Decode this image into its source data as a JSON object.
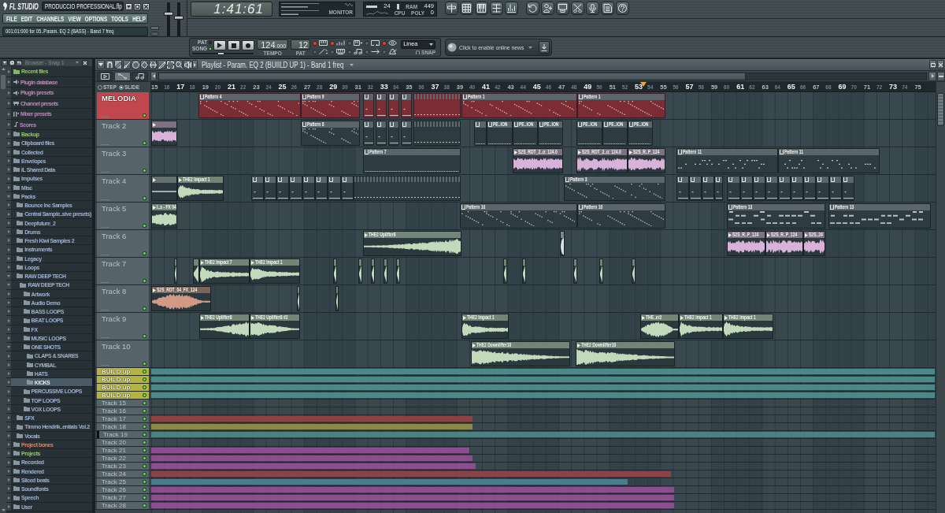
{
  "app": {
    "logo": "FL STUDIO",
    "title": "PRODUCCIO PROFESSIONAL.flp",
    "menu": [
      "FILE",
      "EDIT",
      "CHANNELS",
      "VIEW",
      "OPTIONS",
      "TOOLS",
      "HELP"
    ],
    "hint": "001:01:000 for 05..Param. EQ 2 (BASS) - Band 7 freq"
  },
  "master": {
    "volume": {
      "level": 0.68
    },
    "pitch": {
      "level": 0.55
    }
  },
  "song_time": "1:41:61",
  "monitor": {
    "label": "MONITOR"
  },
  "performance": {
    "cpu": "24",
    "ram_label": "RAM",
    "poly": "449",
    "cpu_label": "CPU",
    "poly_label": "POLY",
    "count": "0"
  },
  "transport": {
    "modes": [
      {
        "label": "PAT",
        "selected": false
      },
      {
        "label": "SONG",
        "selected": true
      }
    ],
    "position": {
      "level": 0.47
    },
    "tempo": "124",
    "tempo_decimals": ".000",
    "tempo_label": "TEMPO",
    "pattern": "12",
    "pattern_label": "PAT",
    "toggles": [
      {
        "on": true
      },
      {
        "on": true
      },
      {
        "on": false
      },
      {
        "on": false
      },
      {
        "on": true
      },
      {
        "on": false
      },
      {
        "on": false
      },
      {
        "on": false
      },
      {
        "on": false
      },
      {
        "on": false
      }
    ]
  },
  "snap": {
    "value": "Linea",
    "label": "SNAP"
  },
  "news": {
    "text": "Click to enable online news"
  },
  "browser": {
    "title": "Browser - Snap 1",
    "items": [
      {
        "label": "Recent files",
        "kind": "recent",
        "color": "#8ec46a",
        "expanded": false,
        "selected": false
      },
      {
        "label": "Plugin database",
        "kind": "plugin",
        "color": "#b98bbb",
        "expanded": false,
        "selected": false
      },
      {
        "label": "Plugin presets",
        "kind": "plugin",
        "color": "#b98bbb",
        "expanded": false,
        "selected": false
      },
      {
        "label": "Channel presets",
        "kind": "channel",
        "color": "#b98bbb",
        "expanded": false,
        "selected": false
      },
      {
        "label": "Mixer presets",
        "kind": "mixer",
        "color": "#b98bbb",
        "expanded": false,
        "selected": false
      },
      {
        "label": "Scores",
        "kind": "score",
        "color": "#b98bbb",
        "expanded": false,
        "selected": false
      },
      {
        "label": "Backup",
        "kind": "folder",
        "color": "#8ec46a",
        "expanded": false,
        "selected": false
      },
      {
        "label": "Clipboard files",
        "kind": "folder",
        "color": "#9db1cf",
        "expanded": false,
        "selected": false
      },
      {
        "label": "Collected",
        "kind": "folder",
        "color": "#9db1cf",
        "expanded": false,
        "selected": false
      },
      {
        "label": "Envelopes",
        "kind": "folder",
        "color": "#9db1cf",
        "expanded": false,
        "selected": false
      },
      {
        "label": "IL Shared Data",
        "kind": "folder",
        "color": "#9db1cf",
        "expanded": false,
        "selected": false
      },
      {
        "label": "Impulses",
        "kind": "folder",
        "color": "#9db1cf",
        "expanded": false,
        "selected": false
      },
      {
        "label": "Misc",
        "kind": "folder",
        "color": "#9db1cf",
        "expanded": false,
        "selected": false
      },
      {
        "label": "Packs",
        "kind": "folder",
        "color": "#9db1cf",
        "expanded": true,
        "selected": false,
        "children": [
          {
            "label": "Bounce Inc Samples",
            "kind": "folder",
            "color": "#9db1cf",
            "expanded": false,
            "selected": false
          },
          {
            "label": "Central Sample..sive presets)",
            "kind": "folder",
            "color": "#9db1cf",
            "expanded": false,
            "selected": false
          },
          {
            "label": "Deepfuture_2",
            "kind": "folder",
            "color": "#9db1cf",
            "expanded": false,
            "selected": false
          },
          {
            "label": "Drums",
            "kind": "folder",
            "color": "#9db1cf",
            "expanded": false,
            "selected": false
          },
          {
            "label": "Fresh Kiwi Samples 2",
            "kind": "folder",
            "color": "#9db1cf",
            "expanded": false,
            "selected": false
          },
          {
            "label": "Instruments",
            "kind": "folder",
            "color": "#9db1cf",
            "expanded": false,
            "selected": false
          },
          {
            "label": "Legacy",
            "kind": "folder",
            "color": "#9db1cf",
            "expanded": false,
            "selected": false
          },
          {
            "label": "Loops",
            "kind": "folder",
            "color": "#9db1cf",
            "expanded": false,
            "selected": false
          },
          {
            "label": "RAW DEEP TECH",
            "kind": "folder",
            "color": "#9db1cf",
            "expanded": true,
            "selected": false,
            "children": [
              {
                "label": "RAW DEEP TECH",
                "kind": "folder",
                "color": "#9db1cf",
                "expanded": true,
                "selected": false,
                "children": [
                  {
                    "label": "Artwork",
                    "kind": "folder",
                    "color": "#9db1cf",
                    "expanded": false,
                    "selected": false
                  },
                  {
                    "label": "Audio Demo",
                    "kind": "folder",
                    "color": "#9db1cf",
                    "expanded": false,
                    "selected": false
                  },
                  {
                    "label": "BASS LOOPS",
                    "kind": "folder",
                    "color": "#9db1cf",
                    "expanded": false,
                    "selected": false
                  },
                  {
                    "label": "BEAT LOOPS",
                    "kind": "folder",
                    "color": "#9db1cf",
                    "expanded": false,
                    "selected": false
                  },
                  {
                    "label": "FX",
                    "kind": "folder",
                    "color": "#9db1cf",
                    "expanded": false,
                    "selected": false
                  },
                  {
                    "label": "MUSIC LOOPS",
                    "kind": "folder",
                    "color": "#9db1cf",
                    "expanded": false,
                    "selected": false
                  },
                  {
                    "label": "ONE SHOTS",
                    "kind": "folder",
                    "color": "#9db1cf",
                    "expanded": true,
                    "selected": false,
                    "children": [
                      {
                        "label": "CLAPS & SNARES",
                        "kind": "folder",
                        "color": "#9db1cf",
                        "expanded": false,
                        "selected": false
                      },
                      {
                        "label": "CYMBAL",
                        "kind": "folder",
                        "color": "#9db1cf",
                        "expanded": false,
                        "selected": false
                      },
                      {
                        "label": "HATS",
                        "kind": "folder",
                        "color": "#9db1cf",
                        "expanded": false,
                        "selected": false
                      },
                      {
                        "label": "KICKS",
                        "kind": "folder",
                        "expanded": false,
                        "selected": true
                      }
                    ]
                  },
                  {
                    "label": "PERCUSSIVE LOOPS",
                    "kind": "folder",
                    "color": "#9db1cf",
                    "expanded": false,
                    "selected": false
                  },
                  {
                    "label": "TOP LOOPS",
                    "kind": "folder",
                    "color": "#9db1cf",
                    "expanded": false,
                    "selected": false
                  },
                  {
                    "label": "VOX LOOPS",
                    "kind": "folder",
                    "color": "#9db1cf",
                    "expanded": false,
                    "selected": false
                  }
                ]
              }
            ]
          },
          {
            "label": "SFX",
            "kind": "folder",
            "color": "#9db1cf",
            "expanded": false,
            "selected": false
          },
          {
            "label": "Timmo Hendrik..entials Vol.2",
            "kind": "folder",
            "color": "#9db1cf",
            "expanded": false,
            "selected": false
          },
          {
            "label": "Vocals",
            "kind": "folder",
            "color": "#9db1cf",
            "expanded": false,
            "selected": false
          }
        ]
      },
      {
        "label": "Project bones",
        "kind": "folder",
        "color": "#d9866a",
        "expanded": false,
        "selected": false
      },
      {
        "label": "Projects",
        "kind": "folder",
        "color": "#8ec46a",
        "expanded": false,
        "selected": false
      },
      {
        "label": "Recorded",
        "kind": "folder",
        "color": "#9db1cf",
        "expanded": false,
        "selected": false
      },
      {
        "label": "Rendered",
        "kind": "folder",
        "color": "#9db1cf",
        "expanded": false,
        "selected": false
      },
      {
        "label": "Sliced beats",
        "kind": "folder",
        "color": "#9db1cf",
        "expanded": false,
        "selected": false
      },
      {
        "label": "Soundfonts",
        "kind": "folder",
        "color": "#9db1cf",
        "expanded": false,
        "selected": false
      },
      {
        "label": "Speech",
        "kind": "folder",
        "color": "#9db1cf",
        "expanded": false,
        "selected": false
      },
      {
        "label": "User",
        "kind": "folder",
        "color": "#9db1cf",
        "expanded": false,
        "selected": false
      }
    ]
  },
  "playlist": {
    "title": "Playlist - Param. EQ 2 (BUIILD UP 1) - Band 1 freq",
    "tools": [
      {
        "selected": true
      },
      {
        "selected": false
      },
      {
        "selected": false
      },
      {
        "selected": false
      },
      {
        "selected": false
      },
      {
        "selected": false
      },
      {
        "selected": false
      },
      {
        "selected": false
      },
      {
        "selected": false
      }
    ],
    "views": [
      {
        "selected": false
      },
      {
        "selected": true
      },
      {
        "selected": false
      }
    ],
    "options": [
      {
        "label": "STEP",
        "selected": false
      },
      {
        "label": "SLIDE",
        "selected": true
      }
    ],
    "ruler": [
      "15",
      "16",
      "17",
      "18",
      "19",
      "20",
      "21",
      "22",
      "23",
      "24",
      "25",
      "26",
      "27",
      "28",
      "29",
      "30",
      "31",
      "32",
      "33",
      "34",
      "35",
      "36",
      "37",
      "38",
      "39",
      "40",
      "41",
      "42",
      "43",
      "44",
      "45",
      "46",
      "47",
      "48",
      "49",
      "50",
      "51",
      "52",
      "53",
      "54",
      "55",
      "56",
      "57",
      "58",
      "59",
      "60",
      "61",
      "62",
      "63",
      "64",
      "65",
      "66",
      "67",
      "68",
      "69",
      "70",
      "71",
      "72",
      "73",
      "74",
      "75"
    ],
    "tracks": [
      {
        "name": "MELODIA",
        "kind": "tall",
        "color": "#c0474e",
        "enabled": true,
        "selected": false,
        "clips": [
          {
            "kind": "pattern",
            "label": "Pattern 4",
            "color": "#7b2c35"
          },
          {
            "kind": "pattern",
            "label": "Pattern 9",
            "color": "#7b2c35"
          },
          {
            "kind": "pattern",
            "color": "#7b2c35"
          },
          {
            "kind": "pattern",
            "color": "#7b2c35"
          },
          {
            "kind": "pattern",
            "color": "#7b2c35"
          },
          {
            "kind": "pattern",
            "color": "#7b2c35"
          },
          {
            "kind": "fragments",
            "color": "#7b2c35"
          },
          {
            "kind": "pattern",
            "label": "Pattern 1",
            "color": "#7b2c35"
          },
          {
            "kind": "pattern",
            "label": "Pattern 1",
            "color": "#7b2c35"
          }
        ]
      },
      {
        "name": "Track 2",
        "kind": "tall",
        "color": "#56636a",
        "enabled": true,
        "selected": false,
        "clips": [
          {
            "kind": "audio",
            "color": "#d8b2d8"
          },
          {
            "kind": "pattern",
            "label": "Pattern 8",
            "color": "#2e3c42"
          },
          {
            "kind": "pattern",
            "color": "#2e3c42"
          },
          {
            "kind": "pattern",
            "color": "#2e3c42"
          },
          {
            "kind": "pattern",
            "color": "#2e3c42"
          },
          {
            "kind": "pattern",
            "color": "#2e3c42"
          },
          {
            "kind": "fragments",
            "color": "#2e3c42"
          },
          {
            "kind": "pattern",
            "color": "#2e3c42"
          },
          {
            "kind": "pattern",
            "label": "PE..ION",
            "color": "#2e3c42"
          },
          {
            "kind": "pattern",
            "label": "PE..ION",
            "color": "#2e3c42"
          },
          {
            "kind": "pattern",
            "label": "PE..ION",
            "color": "#2e3c42"
          },
          {
            "kind": "pattern",
            "label": "PE..ION",
            "color": "#2e3c42"
          },
          {
            "kind": "pattern",
            "label": "PE..ION",
            "color": "#2e3c42"
          },
          {
            "kind": "pattern",
            "label": "PE..ION",
            "color": "#2e3c42"
          }
        ]
      },
      {
        "name": "Track 3",
        "kind": "tall",
        "color": "#56636a",
        "enabled": true,
        "selected": false,
        "clips": [
          {
            "kind": "pattern",
            "label": "Pattern 7",
            "color": "#2e3c42"
          },
          {
            "kind": "audio",
            "label": "S2S_RDT_2..o: 124.0",
            "color": "#d8b2d8"
          },
          {
            "kind": "audio",
            "label": "S2S_RDT_2..o: 124.0",
            "color": "#d8b2d8"
          },
          {
            "kind": "audio",
            "label": "S2S_R..P_124",
            "color": "#d8b2d8"
          },
          {
            "kind": "pattern",
            "label": "Pattern 11",
            "color": "#2e3c42"
          },
          {
            "kind": "pattern",
            "label": "Pattern 11",
            "color": "#2e3c42"
          }
        ]
      },
      {
        "name": "Track 4",
        "kind": "tall",
        "color": "#56636a",
        "enabled": true,
        "selected": false,
        "clips": [
          {
            "kind": "audio",
            "color": "#a3aeb2"
          },
          {
            "kind": "audio",
            "label": "THE2 Impact 1",
            "color": "#c2d9bc"
          },
          {
            "kind": "pattern",
            "color": "#2e3c42"
          },
          {
            "kind": "pattern",
            "color": "#2e3c42"
          },
          {
            "kind": "pattern",
            "color": "#2e3c42"
          },
          {
            "kind": "pattern",
            "color": "#2e3c42"
          },
          {
            "kind": "pattern",
            "color": "#2e3c42"
          },
          {
            "kind": "pattern",
            "color": "#2e3c42"
          },
          {
            "kind": "pattern",
            "color": "#2e3c42"
          },
          {
            "kind": "pattern",
            "color": "#2e3c42"
          },
          {
            "kind": "fragments",
            "color": "#2e3c42"
          },
          {
            "kind": "pattern",
            "label": "Pattern 3",
            "color": "#2e3c42"
          },
          {
            "kind": "pattern",
            "color": "#2e3c42"
          },
          {
            "kind": "pattern",
            "color": "#2e3c42"
          },
          {
            "kind": "pattern",
            "color": "#2e3c42"
          },
          {
            "kind": "pattern",
            "color": "#2e3c42"
          },
          {
            "kind": "pattern",
            "color": "#2e3c42"
          },
          {
            "kind": "pattern",
            "color": "#2e3c42"
          },
          {
            "kind": "pattern",
            "color": "#2e3c42"
          },
          {
            "kind": "pattern",
            "color": "#2e3c42"
          },
          {
            "kind": "pattern",
            "color": "#2e3c42"
          },
          {
            "kind": "pattern",
            "color": "#2e3c42"
          },
          {
            "kind": "pattern",
            "color": "#2e3c42"
          },
          {
            "kind": "pattern",
            "color": "#2e3c42"
          },
          {
            "kind": "pattern",
            "color": "#2e3c42"
          },
          {
            "kind": "pattern",
            "color": "#2e3c42"
          }
        ]
      },
      {
        "name": "Track 5",
        "kind": "tall",
        "color": "#56636a",
        "enabled": true,
        "selected": false,
        "clips": [
          {
            "kind": "audio",
            "label": "I..s - FX 04",
            "color": "#c2d9bc"
          },
          {
            "kind": "pattern",
            "label": "Pattern 10",
            "color": "#2e3c42"
          },
          {
            "kind": "pattern",
            "label": "Pattern 10",
            "color": "#2e3c42"
          },
          {
            "kind": "pattern",
            "label": "Pattern 13",
            "color": "#2e3c42"
          },
          {
            "kind": "pattern",
            "label": "Pattern 13",
            "color": "#2e3c42"
          }
        ]
      },
      {
        "name": "Track 6",
        "kind": "tall",
        "color": "#56636a",
        "enabled": true,
        "selected": false,
        "clips": [
          {
            "kind": "audio",
            "label": "THE2 Uplifter6",
            "color": "#c2d9bc"
          },
          {
            "kind": "audio",
            "color": "#d9e0e3"
          },
          {
            "kind": "audio",
            "label": "S2S_R..P_124",
            "color": "#d8b2d8"
          },
          {
            "kind": "audio",
            "label": "S2S_R..P_124",
            "color": "#d8b2d8"
          },
          {
            "kind": "audio",
            "label": "S2S..24",
            "color": "#d8b2d8"
          }
        ]
      },
      {
        "name": "Track 7",
        "kind": "tall",
        "color": "#56636a",
        "enabled": true,
        "selected": false,
        "clips": [
          {
            "kind": "audio",
            "color": "#c2d9bc"
          },
          {
            "kind": "audio",
            "color": "#c2d9bc"
          },
          {
            "kind": "audio",
            "label": "THE2 Impact 7",
            "color": "#c2d9bc"
          },
          {
            "kind": "audio",
            "label": "THE2 Impact 1",
            "color": "#c2d9bc"
          },
          {
            "kind": "audio",
            "color": "#c2d9bc"
          },
          {
            "kind": "audio",
            "color": "#c2d9bc"
          },
          {
            "kind": "audio",
            "color": "#c2d9bc"
          },
          {
            "kind": "audio",
            "color": "#c2d9bc"
          },
          {
            "kind": "audio",
            "color": "#c2d9bc"
          },
          {
            "kind": "audio",
            "color": "#c2d9bc"
          },
          {
            "kind": "audio",
            "color": "#c2d9bc"
          },
          {
            "kind": "audio",
            "color": "#c2d9bc"
          },
          {
            "kind": "audio",
            "color": "#c2d9bc"
          },
          {
            "kind": "audio",
            "color": "#c2d9bc"
          }
        ]
      },
      {
        "name": "Track 8",
        "kind": "tall",
        "color": "#56636a",
        "enabled": true,
        "selected": false,
        "clips": [
          {
            "kind": "audio",
            "label": "S2S_RDT_04_FX_124",
            "color": "#d09a84"
          },
          {
            "kind": "audio",
            "color": "#c2d9bc"
          },
          {
            "kind": "audio",
            "color": "#c2d9bc"
          }
        ]
      },
      {
        "name": "Track 9",
        "kind": "tall",
        "color": "#56636a",
        "enabled": true,
        "selected": false,
        "clips": [
          {
            "kind": "audio",
            "label": "THE2 Uplifter8",
            "color": "#c2d9bc"
          },
          {
            "kind": "audio",
            "label": "THE2 Uplifter8 #2",
            "color": "#c2d9bc"
          },
          {
            "kind": "audio",
            "label": "THE2 Impact 1",
            "color": "#c2d9bc"
          },
          {
            "kind": "audio",
            "label": "THE..er2",
            "color": "#c2d9bc"
          },
          {
            "kind": "audio",
            "label": "THE2 Impact 1",
            "color": "#c2d9bc"
          },
          {
            "kind": "audio",
            "label": "THE2 Impact 1",
            "color": "#c2d9bc"
          }
        ]
      },
      {
        "name": "Track 10",
        "kind": "tall",
        "color": "#56636a",
        "enabled": true,
        "selected": false,
        "clips": [
          {
            "kind": "audio",
            "label": "THE2 Downlifter10",
            "color": "#c2d9bc"
          },
          {
            "kind": "audio",
            "label": "THE2 Downlifter10",
            "color": "#c2d9bc"
          }
        ]
      },
      {
        "name": "BUILD up",
        "kind": "compact",
        "color": "#b6b43e",
        "enabled": true,
        "selected": false,
        "clips": [
          {
            "kind": "strip",
            "color": "#4d8888"
          }
        ]
      },
      {
        "name": "BUILD up",
        "kind": "compact",
        "color": "#b6b43e",
        "enabled": true,
        "selected": false,
        "clips": [
          {
            "kind": "strip",
            "color": "#4d8888"
          }
        ]
      },
      {
        "name": "BUILD up",
        "kind": "compact",
        "color": "#b6b43e",
        "enabled": true,
        "selected": false,
        "clips": [
          {
            "kind": "strip",
            "color": "#4d8888"
          }
        ]
      },
      {
        "name": "BUILD up",
        "kind": "compact",
        "color": "#b6b43e",
        "enabled": true,
        "selected": false,
        "clips": [
          {
            "kind": "strip",
            "color": "#4d8888"
          }
        ]
      },
      {
        "name": "Track 15",
        "kind": "compact",
        "color": "#56636a",
        "enabled": true,
        "selected": false
      },
      {
        "name": "Track 16",
        "kind": "compact",
        "color": "#56636a",
        "enabled": true,
        "selected": false
      },
      {
        "name": "Track 17",
        "kind": "compact",
        "color": "#56636a",
        "enabled": true,
        "selected": false,
        "clips": [
          {
            "kind": "strip",
            "color": "#8d4242"
          }
        ]
      },
      {
        "name": "Track 18",
        "kind": "compact",
        "color": "#56636a",
        "enabled": true,
        "selected": false,
        "clips": [
          {
            "kind": "strip",
            "color": "#8a8a46"
          }
        ]
      },
      {
        "name": "Track 19",
        "kind": "compact",
        "color": "#56636a",
        "enabled": true,
        "selected": true,
        "clips": [
          {
            "kind": "strip",
            "color": "#4d8080"
          }
        ]
      },
      {
        "name": "Track 20",
        "kind": "compact",
        "color": "#56636a",
        "enabled": true,
        "selected": false
      },
      {
        "name": "Track 21",
        "kind": "compact",
        "color": "#56636a",
        "enabled": true,
        "selected": false,
        "clips": [
          {
            "kind": "strip",
            "color": "#8c4e8e"
          }
        ]
      },
      {
        "name": "Track 22",
        "kind": "compact",
        "color": "#56636a",
        "enabled": true,
        "selected": false,
        "clips": [
          {
            "kind": "strip",
            "color": "#8c4e8e"
          }
        ]
      },
      {
        "name": "Track 23",
        "kind": "compact",
        "color": "#56636a",
        "enabled": true,
        "selected": false,
        "clips": [
          {
            "kind": "strip",
            "color": "#8c4e8e"
          }
        ]
      },
      {
        "name": "Track 24",
        "kind": "compact",
        "color": "#56636a",
        "enabled": true,
        "selected": false,
        "clips": [
          {
            "kind": "strip",
            "color": "#8a4346"
          }
        ]
      },
      {
        "name": "Track 25",
        "kind": "compact",
        "color": "#56636a",
        "enabled": true,
        "selected": false,
        "clips": [
          {
            "kind": "strip",
            "color": "#4b7b8c"
          }
        ]
      },
      {
        "name": "Track 26",
        "kind": "compact",
        "color": "#56636a",
        "enabled": true,
        "selected": false,
        "clips": [
          {
            "kind": "strip",
            "color": "#8c4e8e"
          }
        ]
      },
      {
        "name": "Track 27",
        "kind": "compact",
        "color": "#56636a",
        "enabled": true,
        "selected": false,
        "clips": [
          {
            "kind": "strip",
            "color": "#8c4e8e"
          }
        ]
      },
      {
        "name": "Track 28",
        "kind": "compact",
        "color": "#56636a",
        "enabled": true,
        "selected": false,
        "clips": [
          {
            "kind": "strip",
            "color": "#8c4e8e"
          }
        ]
      }
    ]
  }
}
